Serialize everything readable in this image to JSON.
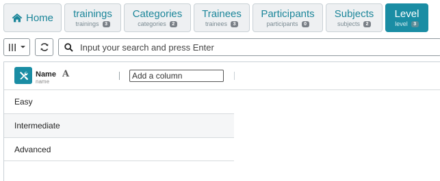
{
  "nav": {
    "home": {
      "label": "Home",
      "icon": "home-icon"
    },
    "tabs": [
      {
        "label": "trainings",
        "sub": "trainings",
        "count": "3"
      },
      {
        "label": "Categories",
        "sub": "categories",
        "count": "2"
      },
      {
        "label": "Trainees",
        "sub": "trainees",
        "count": "3"
      },
      {
        "label": "Participants",
        "sub": "participants",
        "count": "0"
      },
      {
        "label": "Subjects",
        "sub": "subjects",
        "count": "2"
      },
      {
        "label": "Level",
        "sub": "level",
        "count": "3",
        "active": true
      }
    ]
  },
  "toolbar": {
    "columns_icon": "columns-icon",
    "refresh_icon": "refresh-icon",
    "search_icon": "search-icon",
    "search_placeholder": "Input your search and press Enter"
  },
  "grid": {
    "column": {
      "title": "Name",
      "subtitle": "name",
      "type_glyph": "A",
      "tools_icon": "tools-icon"
    },
    "add_column_placeholder": "Add a column",
    "rows": [
      "Easy",
      "Intermediate",
      "Advanced"
    ]
  },
  "colors": {
    "accent": "#1a8da4",
    "tab_bg": "#eef0f2",
    "tab_text": "#1a8599",
    "badge": "#7a8087"
  }
}
